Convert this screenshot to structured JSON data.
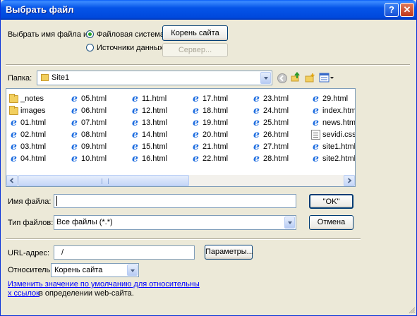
{
  "window": {
    "title": "Выбрать файл"
  },
  "source": {
    "label": "Выбрать имя файла из:",
    "options": [
      {
        "label": "Файловая система",
        "selected": true
      },
      {
        "label": "Источники данных",
        "selected": false
      }
    ],
    "site_root_button": "Корень сайта",
    "server_button": "Сервер..."
  },
  "folder": {
    "label": "Папка:",
    "value": "Site1"
  },
  "files": [
    {
      "name": "_notes",
      "icon": "folder-icon"
    },
    {
      "name": "images",
      "icon": "folder-icon"
    },
    {
      "name": "01.html",
      "icon": "html-file-icon"
    },
    {
      "name": "02.html",
      "icon": "html-file-icon"
    },
    {
      "name": "03.html",
      "icon": "html-file-icon"
    },
    {
      "name": "04.html",
      "icon": "html-file-icon"
    },
    {
      "name": "05.html",
      "icon": "html-file-icon"
    },
    {
      "name": "06.html",
      "icon": "html-file-icon"
    },
    {
      "name": "07.html",
      "icon": "html-file-icon"
    },
    {
      "name": "08.html",
      "icon": "html-file-icon"
    },
    {
      "name": "09.html",
      "icon": "html-file-icon"
    },
    {
      "name": "10.html",
      "icon": "html-file-icon"
    },
    {
      "name": "11.html",
      "icon": "html-file-icon"
    },
    {
      "name": "12.html",
      "icon": "html-file-icon"
    },
    {
      "name": "13.html",
      "icon": "html-file-icon"
    },
    {
      "name": "14.html",
      "icon": "html-file-icon"
    },
    {
      "name": "15.html",
      "icon": "html-file-icon"
    },
    {
      "name": "16.html",
      "icon": "html-file-icon"
    },
    {
      "name": "17.html",
      "icon": "html-file-icon"
    },
    {
      "name": "18.html",
      "icon": "html-file-icon"
    },
    {
      "name": "19.html",
      "icon": "html-file-icon"
    },
    {
      "name": "20.html",
      "icon": "html-file-icon"
    },
    {
      "name": "21.html",
      "icon": "html-file-icon"
    },
    {
      "name": "22.html",
      "icon": "html-file-icon"
    },
    {
      "name": "23.html",
      "icon": "html-file-icon"
    },
    {
      "name": "24.html",
      "icon": "html-file-icon"
    },
    {
      "name": "25.html",
      "icon": "html-file-icon"
    },
    {
      "name": "26.html",
      "icon": "html-file-icon"
    },
    {
      "name": "27.html",
      "icon": "html-file-icon"
    },
    {
      "name": "28.html",
      "icon": "html-file-icon"
    },
    {
      "name": "29.html",
      "icon": "html-file-icon"
    },
    {
      "name": "index.html",
      "icon": "html-file-icon"
    },
    {
      "name": "news.html",
      "icon": "html-file-icon"
    },
    {
      "name": "sevidi.css",
      "icon": "css-file-icon"
    },
    {
      "name": "site1.html",
      "icon": "html-file-icon"
    },
    {
      "name": "site2.html",
      "icon": "html-file-icon"
    }
  ],
  "filename": {
    "label": "Имя файла:",
    "value": ""
  },
  "filetype": {
    "label": "Тип файлов:",
    "value": "Все файлы (*.*)"
  },
  "buttons": {
    "ok": "\"OK\"",
    "cancel": "Отмена",
    "params": "Параметры..."
  },
  "url": {
    "label": "URL-адрес:",
    "value": "/"
  },
  "relative": {
    "label": "Относительно:",
    "value": "Корень сайта"
  },
  "help": {
    "link": "Изменить значение по умолчанию для относительных ссылок",
    "link_line1": "Изменить значение по умолчанию для относительны",
    "link_line2": "х ссылок",
    "suffix": " в определении web-сайта."
  }
}
